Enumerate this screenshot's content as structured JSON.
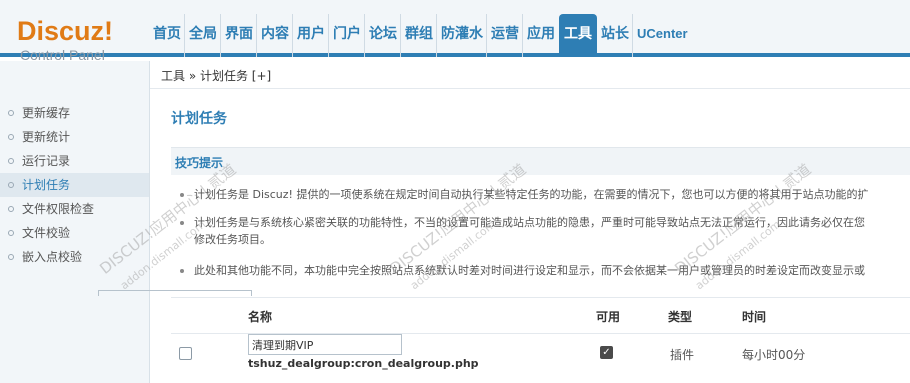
{
  "logo": {
    "brand": "Discuz!",
    "subtitle": "Control Panel"
  },
  "topnav": [
    "首页",
    "全局",
    "界面",
    "内容",
    "用户",
    "门户",
    "论坛",
    "群组",
    "防灌水",
    "运营",
    "应用",
    "工具",
    "站长",
    "UCenter"
  ],
  "topnav_active": "工具",
  "breadcrumb": "工具 » 计划任务 [+]",
  "sidebar": {
    "items": [
      {
        "label": "更新缓存"
      },
      {
        "label": "更新统计"
      },
      {
        "label": "运行记录"
      },
      {
        "label": "计划任务"
      },
      {
        "label": "文件权限检查"
      },
      {
        "label": "文件校验"
      },
      {
        "label": "嵌入点校验"
      }
    ],
    "active": "计划任务"
  },
  "main": {
    "title": "计划任务",
    "tips_heading": "技巧提示",
    "tips": [
      "计划任务是 Discuz! 提供的一项使系统在规定时间自动执行某些特定任务的功能，在需要的情况下，您也可以方便的将其用于站点功能的扩",
      "计划任务是与系统核心紧密关联的功能特性，不当的设置可能造成站点功能的隐患，严重时可能导致站点无法正常运行，因此请务必仅在您",
      "修改任务项目。",
      "此处和其他功能不同，本功能中完全按照站点系统默认时差对时间进行设定和显示，而不会依据某一用户或管理员的时差设定而改变显示或"
    ]
  },
  "table": {
    "headers": {
      "name": "名称",
      "available": "可用",
      "type": "类型",
      "time": "时间"
    },
    "rows": [
      {
        "name": "清理到期VIP",
        "script": "tshuz_dealgroup:cron_dealgroup.php",
        "available": true,
        "type": "插件",
        "time": "每小时00分"
      }
    ]
  },
  "watermarks": {
    "text1": "DISCUZ!应用中心 | 贰道",
    "text2": "addon.dismall.com"
  },
  "colors": {
    "accent": "#2e7eb4",
    "logo": "#e07b16"
  }
}
